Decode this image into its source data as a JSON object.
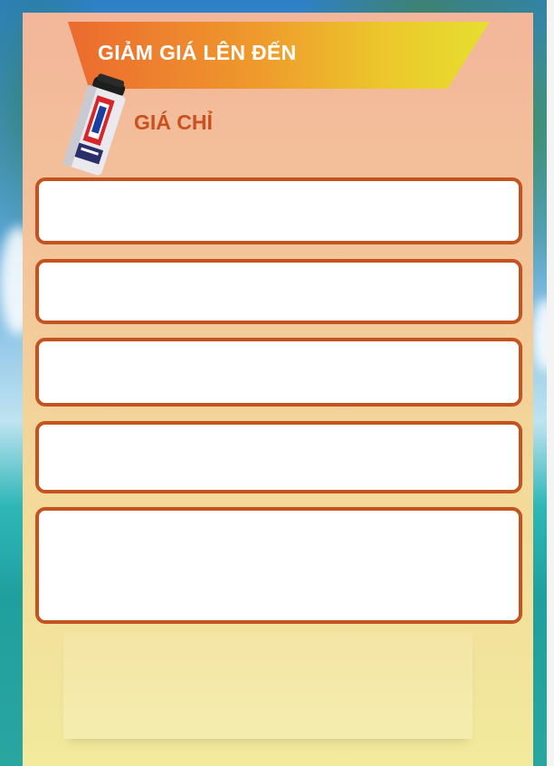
{
  "banner": {
    "title": "GIẢM GIÁ LÊN ĐẾN"
  },
  "price": {
    "label": "GIÁ CHỈ"
  },
  "product": {
    "icon": "spray-can-icon",
    "brand_color": "#d8242b"
  },
  "info_boxes": [
    {
      "text": ""
    },
    {
      "text": ""
    },
    {
      "text": ""
    },
    {
      "text": ""
    },
    {
      "text": ""
    }
  ],
  "colors": {
    "accent": "#c4531f",
    "banner_start": "#ec6a2f",
    "banner_end": "#e6df2e",
    "panel_top": "#f3b69a",
    "panel_bottom": "#f2ea9c"
  }
}
